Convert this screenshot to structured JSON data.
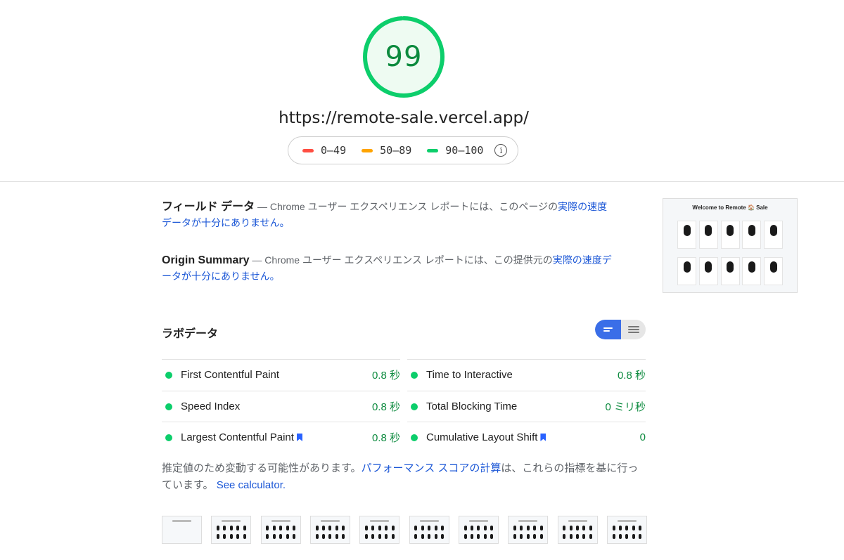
{
  "score": {
    "value": "99",
    "color": "#0cce6b",
    "fraction": 0.99
  },
  "url": "https://remote-sale.vercel.app/",
  "legend": [
    {
      "label": "0–49",
      "color": "#ff4e42"
    },
    {
      "label": "50–89",
      "color": "#ffa400"
    },
    {
      "label": "90–100",
      "color": "#0cce6b"
    }
  ],
  "field": {
    "title": "フィールド データ",
    "text": " — Chrome ユーザー エクスペリエンス レポートには、このページの",
    "link": "実際の速度データが十分にありません。"
  },
  "origin": {
    "title": "Origin Summary",
    "text": " — Chrome ユーザー エクスペリエンス レポートには、この提供元の",
    "link": "実際の速度データが十分にありません。"
  },
  "screenshot": {
    "title": "Welcome to Remote 🏠 Sale"
  },
  "lab": {
    "title": "ラボデータ"
  },
  "metrics": [
    {
      "label": "First Contentful Paint",
      "value": "0.8 秒"
    },
    {
      "label": "Time to Interactive",
      "value": "0.8 秒"
    },
    {
      "label": "Speed Index",
      "value": "0.8 秒"
    },
    {
      "label": "Total Blocking Time",
      "value": "0 ミリ秒"
    },
    {
      "label": "Largest Contentful Paint",
      "value": "0.8 秒"
    },
    {
      "label": "Cumulative Layout Shift",
      "value": "0"
    }
  ],
  "note": {
    "text1": "推定値のため変動する可能性があります。",
    "link1": "パフォーマンス スコアの計算",
    "text2": "は、これらの指標を基に行っています。",
    "link2": "See calculator."
  },
  "colors": {
    "pass": "#0cce6b",
    "link": "#1a56d6",
    "toggle": "#3a6ee8"
  }
}
